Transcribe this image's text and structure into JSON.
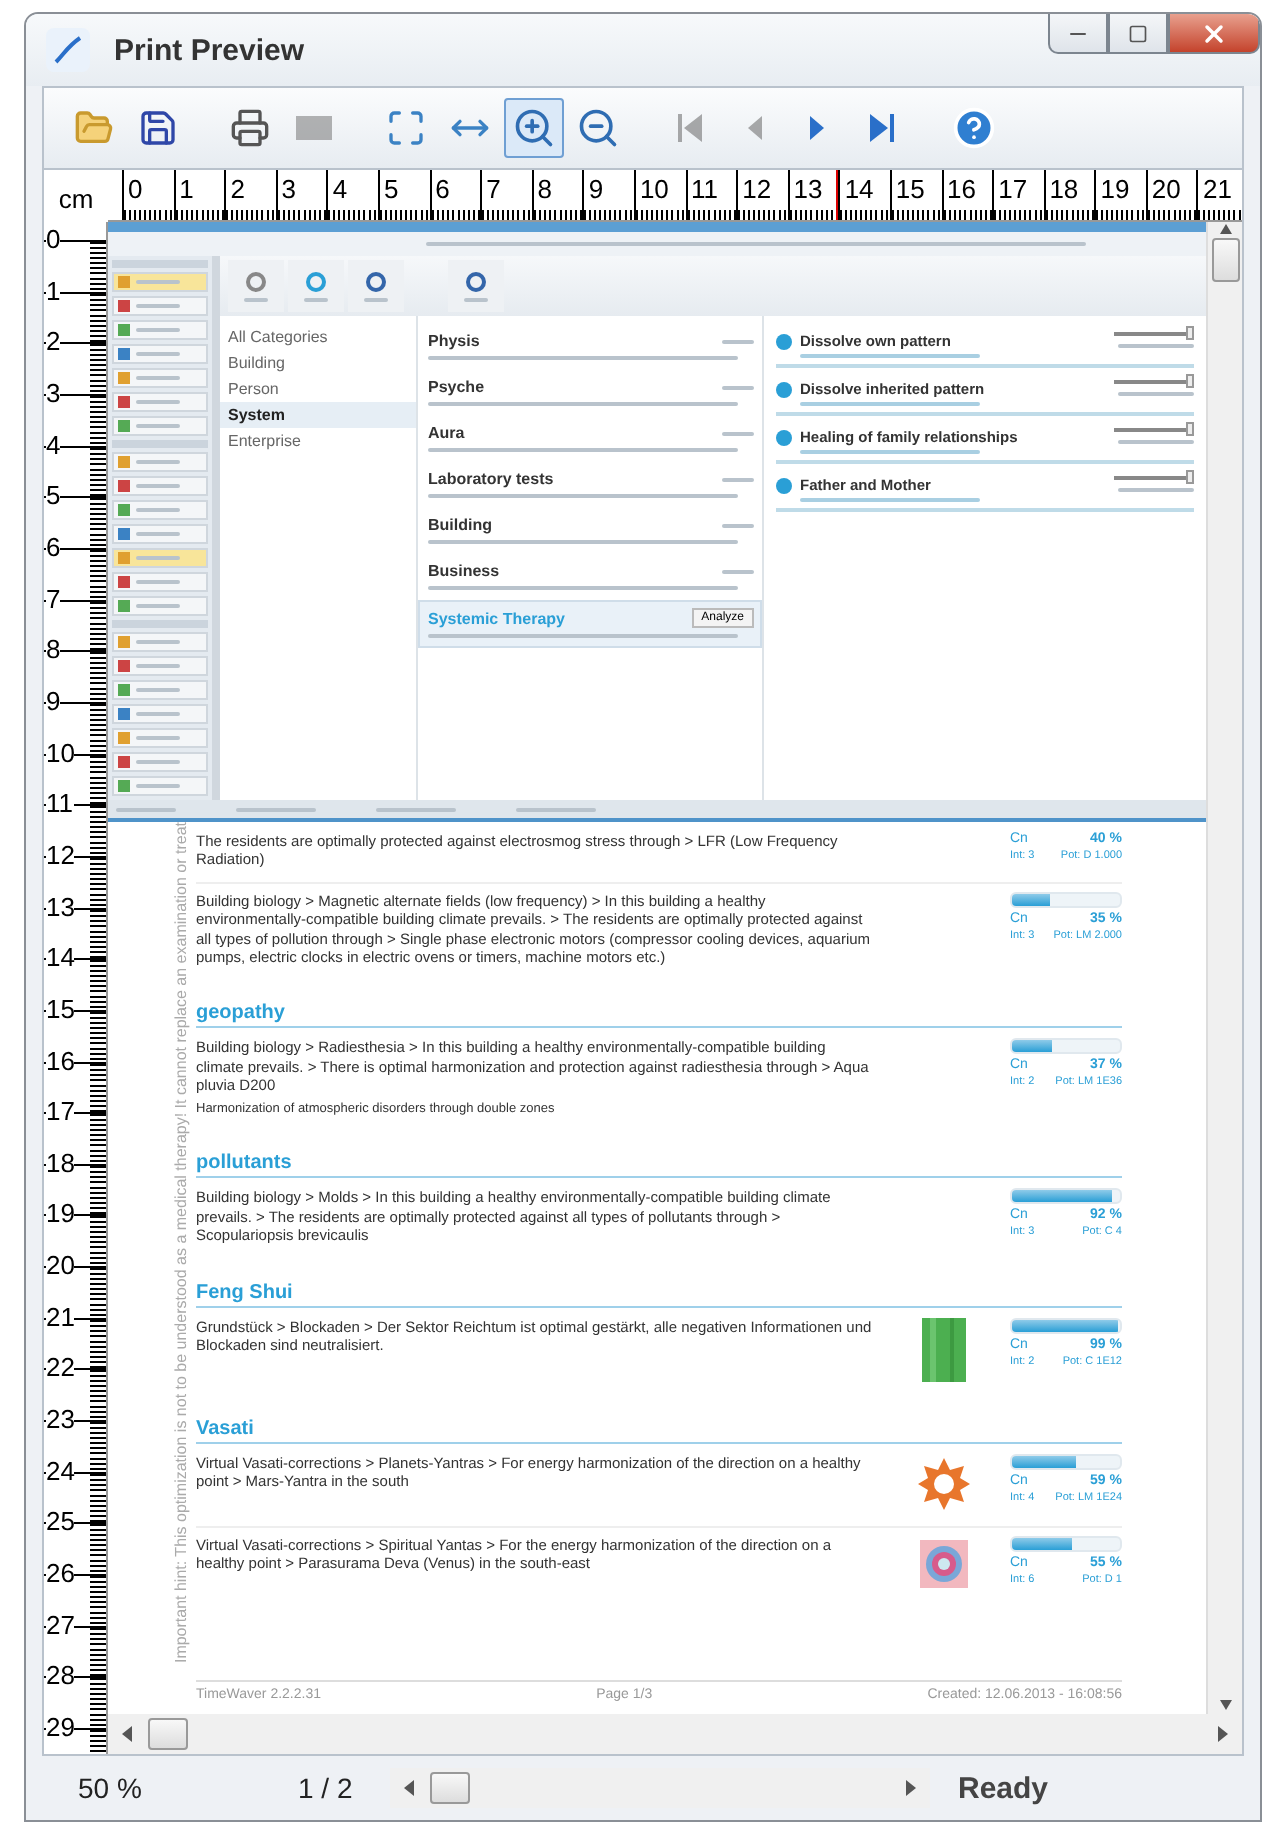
{
  "window": {
    "title": "Print Preview"
  },
  "toolbar": [
    {
      "kind": "open",
      "selected": false,
      "disabled": false
    },
    {
      "kind": "save",
      "selected": false,
      "disabled": false
    },
    {
      "kind": "print",
      "selected": false,
      "disabled": false
    },
    {
      "kind": "page",
      "selected": false,
      "disabled": true
    },
    {
      "kind": "fit-page",
      "selected": false,
      "disabled": false
    },
    {
      "kind": "fit-width",
      "selected": false,
      "disabled": false
    },
    {
      "kind": "zoom-in",
      "selected": true,
      "disabled": false
    },
    {
      "kind": "zoom-out",
      "selected": false,
      "disabled": false
    },
    {
      "kind": "first",
      "selected": false,
      "disabled": true
    },
    {
      "kind": "prev",
      "selected": false,
      "disabled": true
    },
    {
      "kind": "next",
      "selected": false,
      "disabled": false
    },
    {
      "kind": "last",
      "selected": false,
      "disabled": false
    },
    {
      "kind": "help",
      "selected": false,
      "disabled": false
    }
  ],
  "ruler": {
    "unit": "cm",
    "h_marks": [
      "0",
      "1",
      "2",
      "3",
      "4",
      "5",
      "6",
      "7",
      "8",
      "9",
      "10",
      "11",
      "12",
      "13",
      "14",
      "15",
      "16",
      "17",
      "18",
      "19",
      "20",
      "21"
    ],
    "v_marks": [
      "0",
      "1",
      "2",
      "3",
      "4",
      "5",
      "6",
      "7",
      "8",
      "9",
      "10",
      "11",
      "12",
      "13",
      "14",
      "15",
      "16",
      "17",
      "18",
      "19",
      "20",
      "21",
      "22",
      "23",
      "24",
      "25",
      "26",
      "27",
      "28",
      "29"
    ]
  },
  "embedded_app": {
    "categories": [
      {
        "label": "All Categories",
        "selected": false
      },
      {
        "label": "Building",
        "selected": false
      },
      {
        "label": "Person",
        "selected": false
      },
      {
        "label": "System",
        "selected": true
      },
      {
        "label": "Enterprise",
        "selected": false
      }
    ],
    "themes": [
      {
        "name": "Physis",
        "selected": false
      },
      {
        "name": "Psyche",
        "selected": false
      },
      {
        "name": "Aura",
        "selected": false
      },
      {
        "name": "Laboratory tests",
        "selected": false
      },
      {
        "name": "Building",
        "selected": false
      },
      {
        "name": "Business",
        "selected": false
      },
      {
        "name": "Systemic Therapy",
        "selected": true,
        "action": "Analyze"
      }
    ],
    "patterns": [
      {
        "title": "Dissolve own pattern",
        "level": 0.95
      },
      {
        "title": "Dissolve inherited pattern",
        "level": 0.95
      },
      {
        "title": "Healing of family relationships",
        "level": 0.95
      },
      {
        "title": "Father and Mother",
        "level": 0.95
      }
    ]
  },
  "report": {
    "hint": "Important hint: This optimization is not to be understood as a medical therapy! It cannot replace an examination or treat",
    "sections": [
      {
        "entries": [
          {
            "text": "The residents are optimally protected against electrosmog stress through > LFR (Low Frequency Radiation)",
            "cn_label": "Cn",
            "cn": "40 %",
            "int": "Int: 3",
            "pot": "Pot: D 1.000"
          },
          {
            "text": "Building biology > Magnetic alternate fields (low frequency) > In this building a healthy environmentally-compatible building climate prevails. > The residents are optimally protected against all types of pollution through > Single phase electronic motors (compressor cooling devices, aquarium pumps, electric clocks in electric ovens or timers, machine motors etc.)",
            "level": 0.35,
            "cn_label": "Cn",
            "cn": "35 %",
            "int": "Int: 3",
            "pot": "Pot: LM 2.000"
          }
        ]
      },
      {
        "title": "geopathy",
        "entries": [
          {
            "text": "Building biology > Radiesthesia > In this building a healthy environmentally-compatible building climate prevails. > There is optimal harmonization and protection against radiesthesia through > Aqua pluvia D200",
            "note": "Harmonization of atmospheric disorders through double zones",
            "level": 0.37,
            "cn_label": "Cn",
            "cn": "37 %",
            "int": "Int: 2",
            "pot": "Pot: LM 1E36"
          }
        ]
      },
      {
        "title": "pollutants",
        "entries": [
          {
            "text": "Building biology > Molds > In this building a healthy environmentally-compatible building climate prevails. > The residents are optimally protected against all types of pollutants through > Scopulariopsis brevicaulis",
            "level": 0.92,
            "cn_label": "Cn",
            "cn": "92 %",
            "int": "Int: 3",
            "pot": "Pot: C 4"
          }
        ]
      },
      {
        "title": "Feng Shui",
        "entries": [
          {
            "text": "Grundstück > Blockaden > Der Sektor Reichtum ist optimal gestärkt, alle negativen Informationen und Blockaden sind neutralisiert.",
            "kind": "green-tile",
            "level": 0.99,
            "cn_label": "Cn",
            "cn": "99 %",
            "int": "Int: 2",
            "pot": "Pot: C 1E12"
          }
        ]
      },
      {
        "title": "Vasati",
        "entries": [
          {
            "text": "Virtual Vasati-corrections > Planets-Yantras > For energy harmonization of the direction on a healthy point > Mars-Yantra in the south",
            "kind": "star-yantra",
            "level": 0.59,
            "cn_label": "Cn",
            "cn": "59 %",
            "int": "Int: 4",
            "pot": "Pot: LM 1E24"
          },
          {
            "text": "Virtual Vasati-corrections > Spiritual Yantas > For the energy harmonization of the direction on a healthy point > Parasurama Deva (Venus) in the south-east",
            "kind": "square-yantra",
            "level": 0.55,
            "cn_label": "Cn",
            "cn": "55 %",
            "int": "Int: 6",
            "pot": "Pot: D 1"
          }
        ]
      }
    ],
    "footer": {
      "left": "TimeWaver 2.2.2.31",
      "center": "Page 1/3",
      "right": "Created: 12.06.2013 - 16:08:56"
    }
  },
  "status": {
    "zoom": "50 %",
    "page": "1 / 2",
    "state": "Ready"
  }
}
